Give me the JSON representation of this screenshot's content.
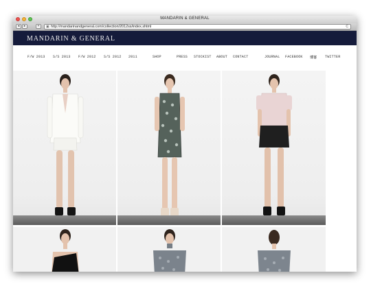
{
  "window": {
    "title": "MANDARIN & GENERAL"
  },
  "toolbar": {
    "back_glyph": "◂",
    "forward_glyph": "▸",
    "add_glyph": "+",
    "url": "http://mandarinandgeneral.com/collection/2012ss/index.shtml",
    "reload_glyph": "C"
  },
  "header": {
    "logo": "MANDARIN & GENERAL"
  },
  "nav": {
    "items": [
      {
        "label": "F/W 2013"
      },
      {
        "label": "S/S 2013"
      },
      {
        "label": "F/W 2012"
      },
      {
        "label": "S/S 2012"
      },
      {
        "label": "2011"
      },
      {
        "label": "SHOP"
      },
      {
        "label": "PRESS"
      },
      {
        "label": "STOCKIST"
      },
      {
        "label": "ABOUT"
      },
      {
        "label": "CONTACT"
      },
      {
        "label": "JOURNAL"
      },
      {
        "label": "FACEBOOK"
      },
      {
        "label": "博客"
      },
      {
        "label": "TWITTER"
      }
    ]
  },
  "gallery": {
    "photos": [
      {
        "subject": "model-white-blazer-shorts"
      },
      {
        "subject": "model-printed-sheath-dress"
      },
      {
        "subject": "model-pink-blouse-black-shorts"
      },
      {
        "subject": "model-black-one-shoulder-top"
      },
      {
        "subject": "model-grey-print-top"
      },
      {
        "subject": "model-grey-print-top-back"
      }
    ]
  },
  "colors": {
    "header_bg": "#151b3b",
    "logo_text": "#eeeeee"
  }
}
